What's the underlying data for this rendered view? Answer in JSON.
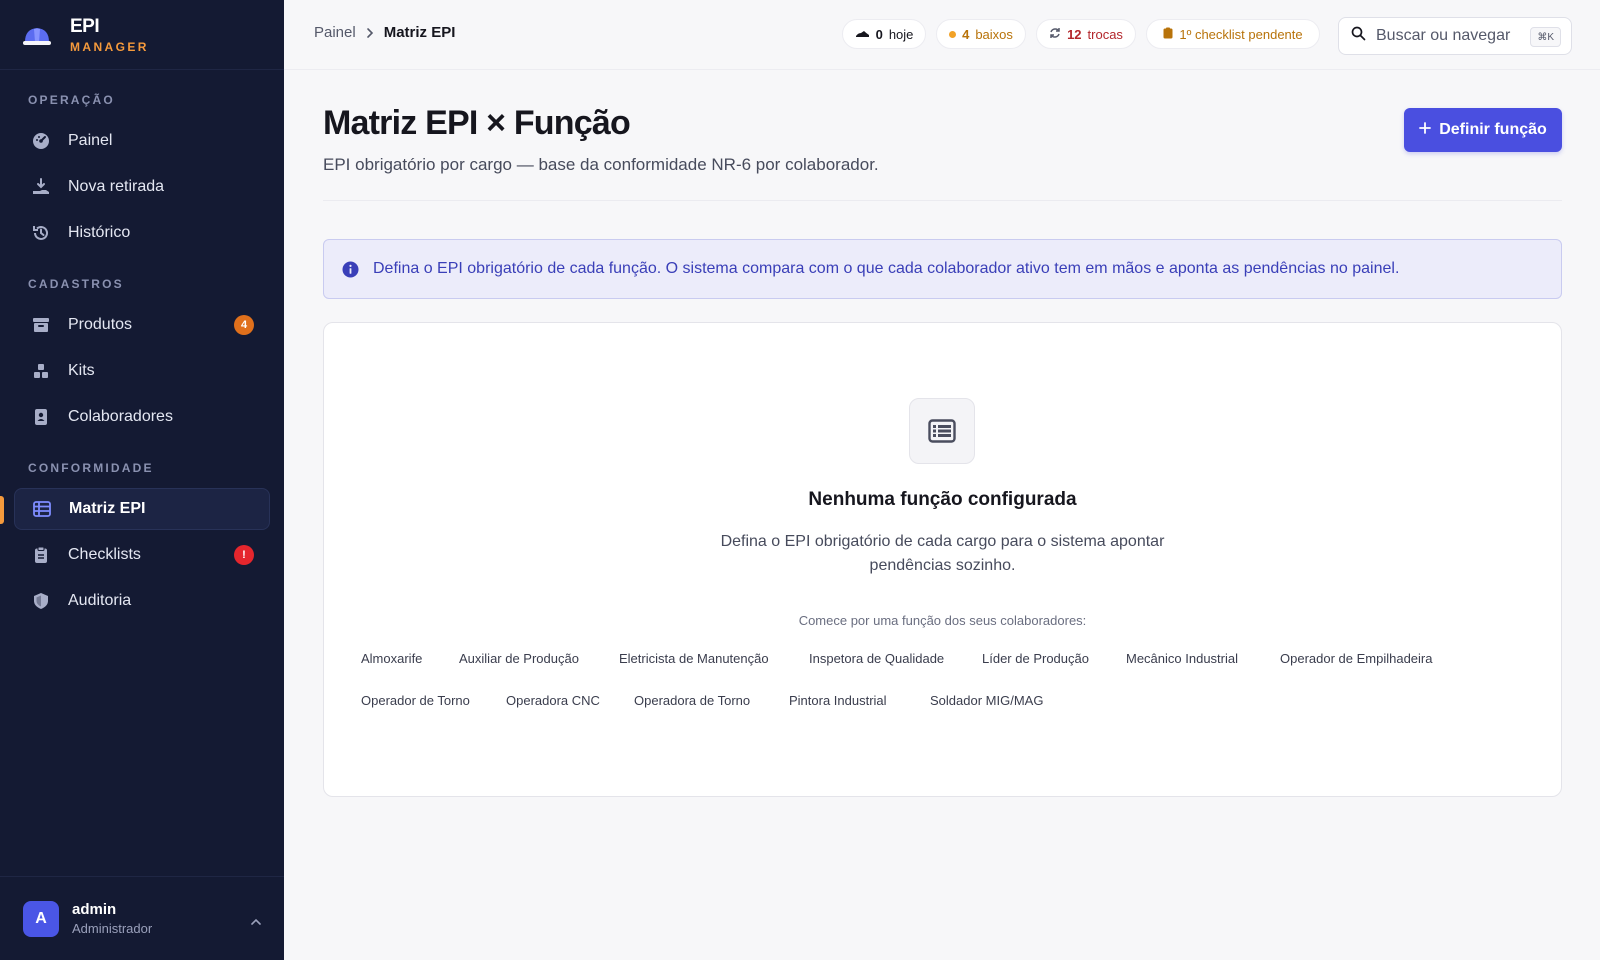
{
  "brand": {
    "title": "EPI",
    "subtitle": "MANAGER"
  },
  "sidebar": {
    "sections": [
      {
        "label": "OPERAÇÃO"
      },
      {
        "label": "CADASTROS"
      },
      {
        "label": "CONFORMIDADE"
      }
    ],
    "items": [
      {
        "label": "Painel",
        "icon": "dashboard-icon"
      },
      {
        "label": "Nova retirada",
        "icon": "hand-receive-icon"
      },
      {
        "label": "Histórico",
        "icon": "history-icon"
      },
      {
        "label": "Produtos",
        "icon": "archive-box-icon",
        "badge": "4"
      },
      {
        "label": "Kits",
        "icon": "boxes-icon"
      },
      {
        "label": "Colaboradores",
        "icon": "id-badge-icon"
      },
      {
        "label": "Matriz EPI",
        "icon": "table-list-icon",
        "active": true
      },
      {
        "label": "Checklists",
        "icon": "clipboard-icon",
        "badge": "!"
      },
      {
        "label": "Auditoria",
        "icon": "shield-icon"
      }
    ],
    "badge_colors": {
      "orange": "#e0701c",
      "red": "#e5262d"
    },
    "accent": "#f59a3c"
  },
  "user": {
    "initial": "A",
    "name": "admin",
    "role": "Administrador"
  },
  "topbar": {
    "breadcrumb": {
      "root": "Painel",
      "current": "Matriz EPI"
    },
    "pills": {
      "today": {
        "count": "0",
        "label": "hoje"
      },
      "low": {
        "count": "4",
        "label": "baixos",
        "color": "#b8730a"
      },
      "swaps": {
        "count": "12",
        "label": "trocas",
        "color": "#b3262b"
      },
      "checklist": {
        "label": "1º checklist pendente",
        "color": "#b8730a"
      }
    },
    "search": {
      "placeholder": "Buscar ou navegar",
      "shortcut": "⌘K"
    }
  },
  "main": {
    "title": "Matriz EPI × Função",
    "subtitle": "EPI obrigatório por cargo — base da conformidade NR-6 por colaborador.",
    "primary_button": "Definir função",
    "info_text": "Defina o EPI obrigatório de cada função. O sistema compara com o que cada colaborador ativo tem em mãos e aponta as pendências no painel.",
    "empty": {
      "title": "Nenhuma função configurada",
      "description": "Defina o EPI obrigatório de cada cargo para o sistema apontar pendências sozinho.",
      "start_label": "Comece por uma função dos seus colaboradores:"
    },
    "roles": [
      "Almoxarife",
      "Auxiliar de Produção",
      "Eletricista de Manutenção",
      "Inspetora de Qualidade",
      "Líder de Produção",
      "Mecânico Industrial",
      "Operador de Empilhadeira",
      "Operador de Torno",
      "Operadora CNC",
      "Operadora de Torno",
      "Pintora Industrial",
      "Soldador MIG/MAG"
    ],
    "primary_color": "#4a4fe0"
  }
}
